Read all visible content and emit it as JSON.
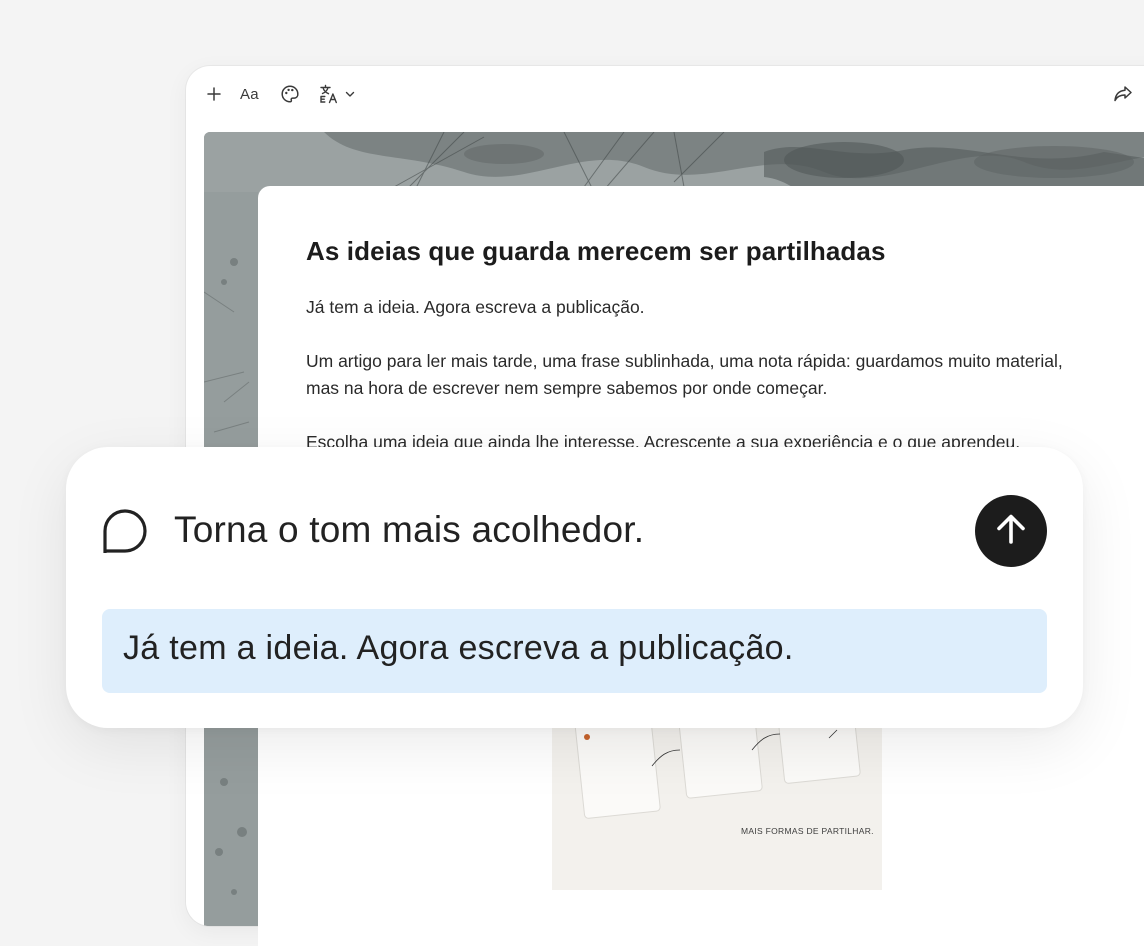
{
  "toolbar": {
    "format_label": "Aa",
    "icons": [
      "plus-icon",
      "palette-icon",
      "translate-icon",
      "chevron-down-icon",
      "share-icon"
    ]
  },
  "document": {
    "title": "As ideias que guarda merecem ser partilhadas",
    "paragraphs": [
      "Já tem a ideia. Agora escreva a publicação.",
      "Um artigo para ler mais tarde, uma frase sublinhada, uma nota rápida: guardamos muito material, mas na hora de escrever nem sempre sabemos por onde começar.",
      "Escolha uma ideia que ainda lhe interesse. Acrescente a sua experiência e o que aprendeu,"
    ],
    "preview_caption": "MAIS FORMAS DE PARTILHAR."
  },
  "prompt": {
    "text": "Torna o tom mais acolhedor.",
    "icon": "chat-bubble-icon",
    "send_icon": "arrow-up-icon",
    "selected_text": "Já tem a ideia. Agora escreva a publicação."
  },
  "colors": {
    "background": "#f4f4f4",
    "selection_highlight": "#deeefc",
    "send_button": "#1c1c1c",
    "accent_dot": "#c8642e"
  }
}
